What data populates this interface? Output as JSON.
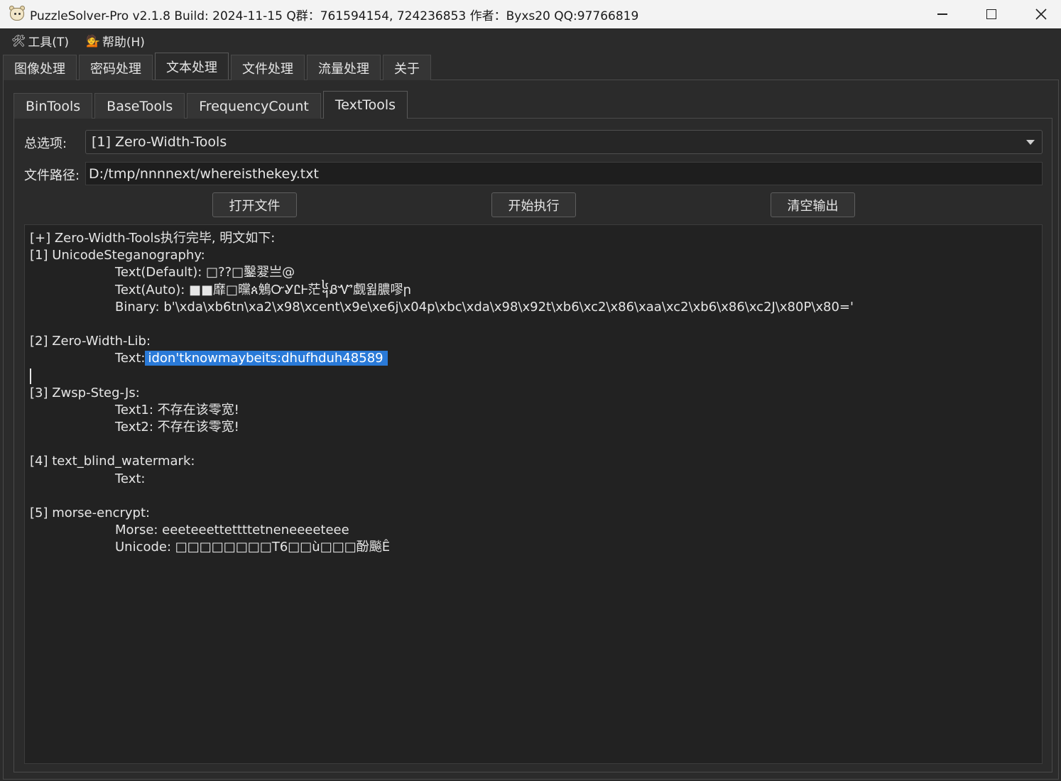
{
  "window": {
    "title": "PuzzleSolver-Pro v2.1.8  Build: 2024-11-15  Q群：761594154, 724236853  作者：Byxs20  QQ:97766819"
  },
  "menu": [
    {
      "icon": "🛠",
      "label": "工具(T)"
    },
    {
      "icon": "💁",
      "label": "帮助(H)"
    }
  ],
  "main_tabs": [
    "图像处理",
    "密码处理",
    "文本处理",
    "文件处理",
    "流量处理",
    "关于"
  ],
  "main_tab_active": "文本处理",
  "sub_tabs": [
    "BinTools",
    "BaseTools",
    "FrequencyCount",
    "TextTools"
  ],
  "sub_tab_active": "TextTools",
  "form": {
    "option_label": "总选项:",
    "option_value": "[1] Zero-Width-Tools",
    "path_label": "文件路径:",
    "path_value": "D:/tmp/nnnnext/whereisthekey.txt"
  },
  "buttons": {
    "open": "打开文件",
    "run": "开始执行",
    "clear": "清空输出"
  },
  "output": {
    "l1": "[+] Zero-Width-Tools执行完毕, 明文如下:",
    "l2": "[1] UnicodeSteganography:",
    "l3": "Text(Default): □??□鑿翇亗@",
    "l4": "Text(Auto): ■■靡□曭ጰ鵵ᏅᎽᏝᎰ茫᧤ᏰᏉ觑윒膿嘐ր",
    "l5": "Binary: b'\\xda\\xb6tn\\xa2\\x98\\xcent\\x9e\\xe6j\\x04p\\xbc\\xda\\x98\\x92t\\xb6\\xc2\\x86\\xaa\\xc2\\xb6\\x86\\xc2J\\x80P\\x80='",
    "l6": "[2] Zero-Width-Lib:",
    "l7_prefix": "Text:",
    "l7_selected": "idon'tknowmaybeits:dhufhduh48589",
    "l8": "[3] Zwsp-Steg-Js:",
    "l9": "Text1: 不存在该零宽!",
    "l10": "Text2: 不存在该零宽!",
    "l11": "[4] text_blind_watermark:",
    "l12": "Text:",
    "l13": "[5] morse-encrypt:",
    "l14": "Morse: eeeteeettettttetneneeeeteee",
    "l15": "Unicode: □□□□□□□□T6□□ù□□□酚飈Ê"
  },
  "colors": {
    "selection": "#2a7ad8",
    "background": "#2b2b2b",
    "output_bg": "#222222"
  }
}
